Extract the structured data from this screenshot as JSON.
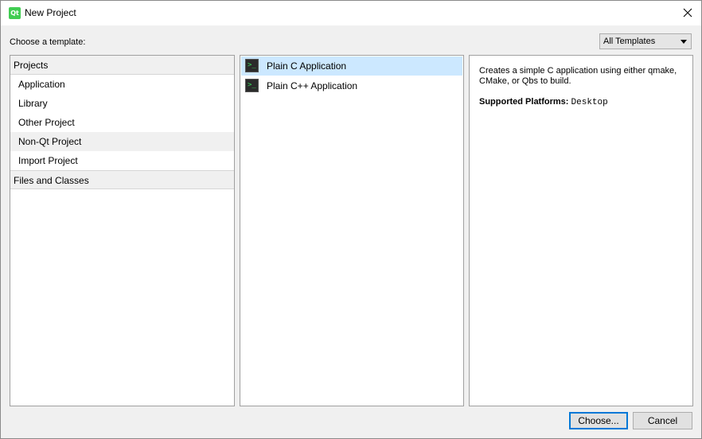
{
  "window": {
    "title": "New Project",
    "app_icon_text": "Qt"
  },
  "header": {
    "choose_label": "Choose a template:",
    "filter_selected": "All Templates"
  },
  "categories": {
    "projects_header": "Projects",
    "items": [
      {
        "label": "Application"
      },
      {
        "label": "Library"
      },
      {
        "label": "Other Project"
      },
      {
        "label": "Non-Qt Project",
        "selected": true
      },
      {
        "label": "Import Project"
      }
    ],
    "files_header": "Files and Classes"
  },
  "templates": [
    {
      "label": "Plain C Application",
      "icon_text": ">_",
      "selected": true
    },
    {
      "label": "Plain C++ Application",
      "icon_text": ">_"
    }
  ],
  "details": {
    "description": "Creates a simple C application using either qmake, CMake, or Qbs to build.",
    "platforms_label": "Supported Platforms:",
    "platforms_value": "Desktop"
  },
  "buttons": {
    "choose": "Choose...",
    "cancel": "Cancel"
  },
  "colors": {
    "selection": "#cce8ff",
    "accent": "#0078d7",
    "qt_green": "#41cd52"
  }
}
